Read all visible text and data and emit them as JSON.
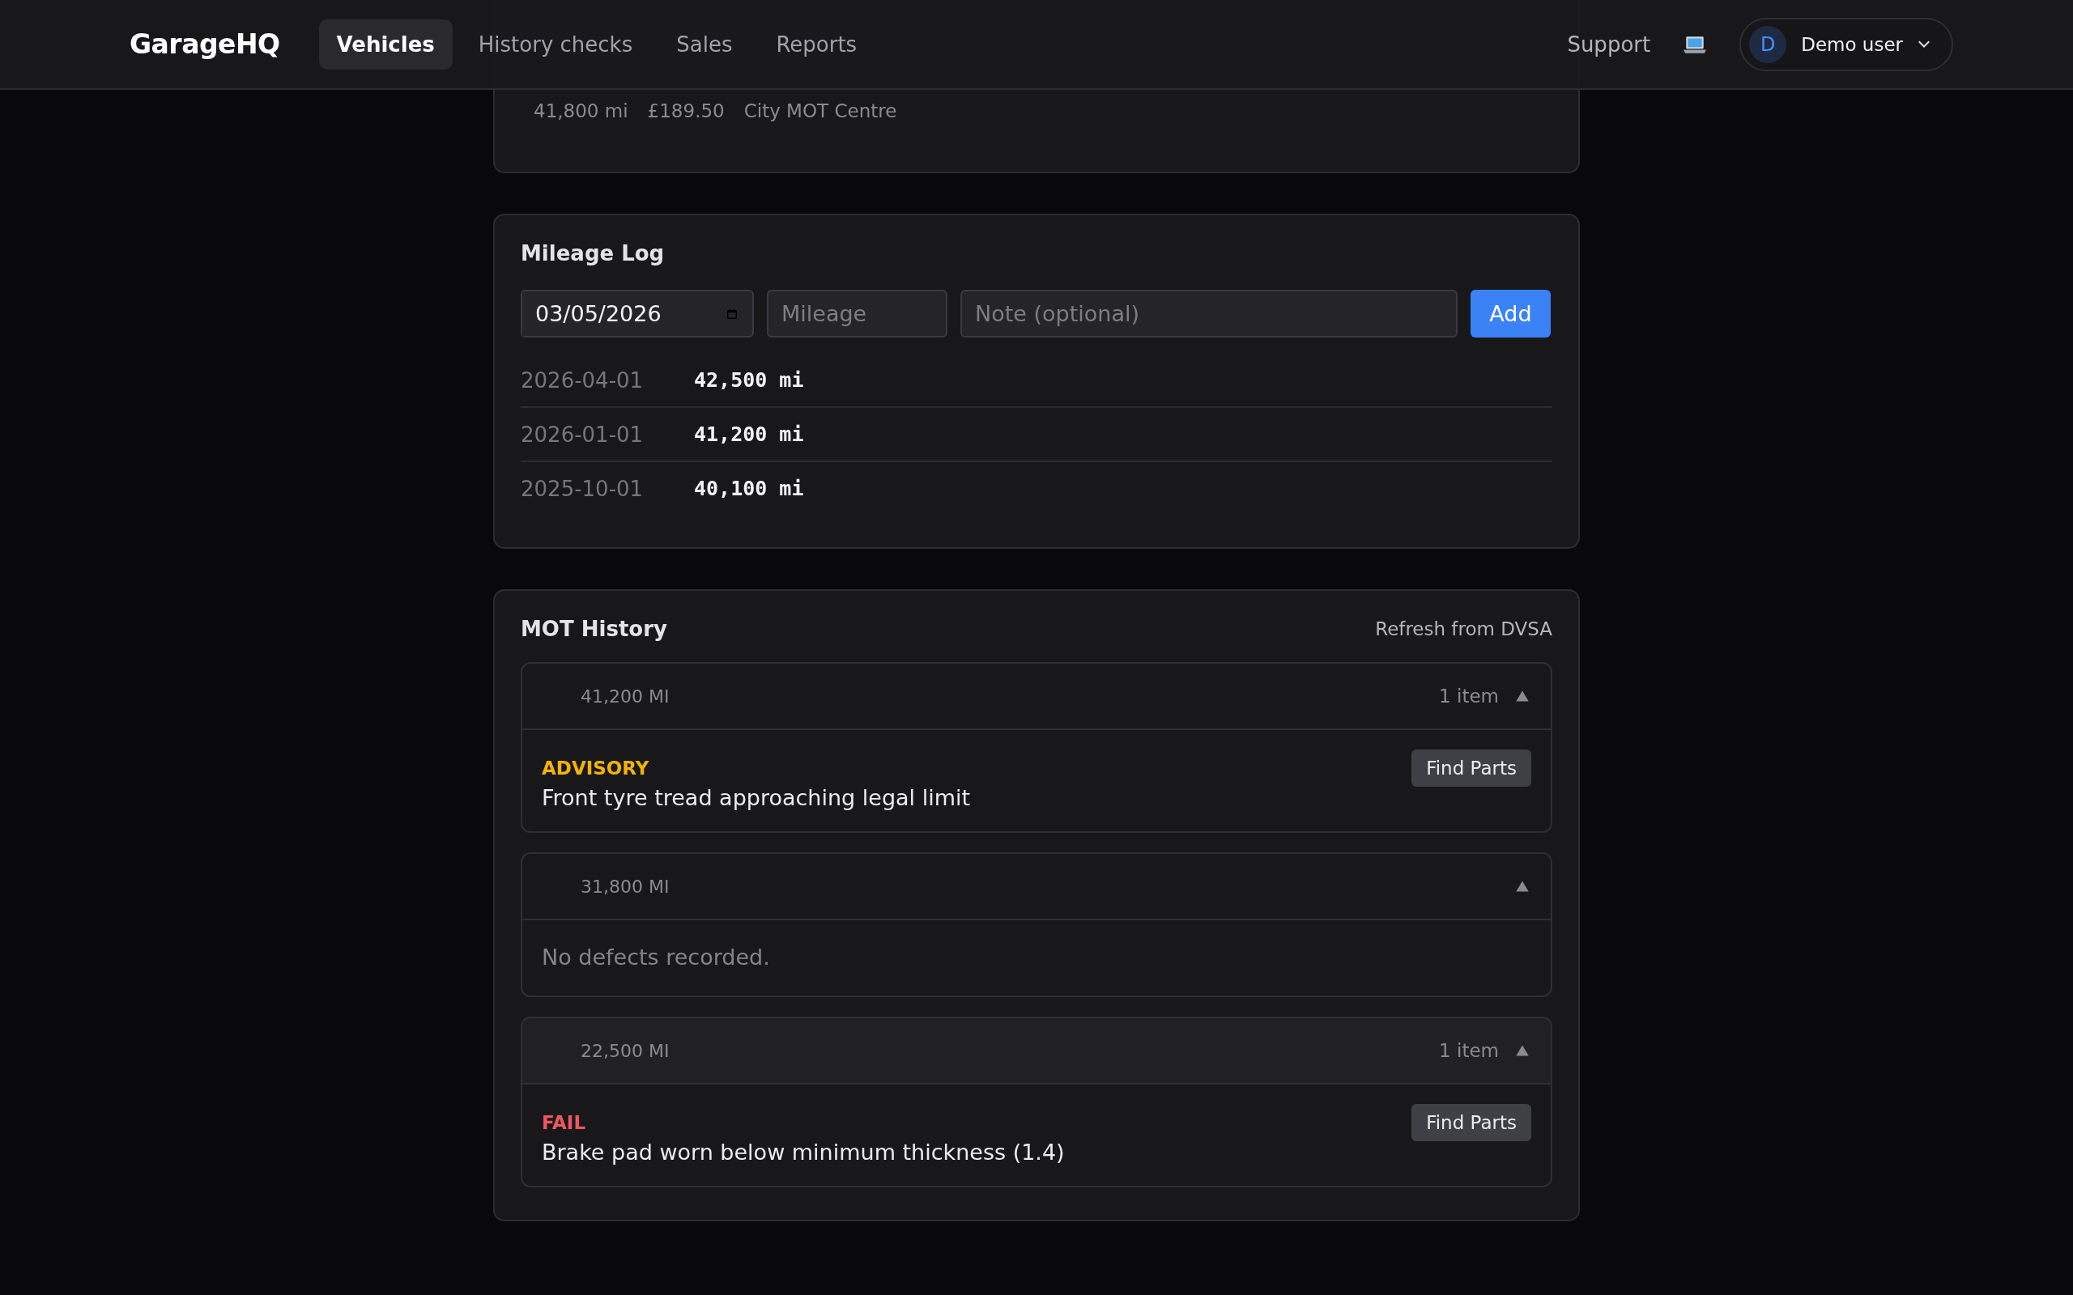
{
  "header": {
    "logo": "GarageHQ",
    "nav": [
      {
        "label": "Vehicles",
        "selected": true
      },
      {
        "label": "History checks",
        "selected": false
      },
      {
        "label": "Sales",
        "selected": false
      },
      {
        "label": "Reports",
        "selected": false
      }
    ],
    "support": "Support",
    "user": {
      "initial": "D",
      "name": "Demo user"
    }
  },
  "service_card": {
    "meta": [
      "41,800 mi",
      "£189.50",
      "City MOT Centre"
    ]
  },
  "mileage_log": {
    "title": "Mileage Log",
    "date_field": {
      "value": "03/05/2026"
    },
    "mileage_field": {
      "placeholder": "Mileage"
    },
    "note_field": {
      "placeholder": "Note (optional)"
    },
    "add_button": "Add",
    "entries": [
      {
        "date": "2026-04-01",
        "mileage": "42,500 mi"
      },
      {
        "date": "2026-01-01",
        "mileage": "41,200 mi"
      },
      {
        "date": "2025-10-01",
        "mileage": "40,100 mi"
      }
    ]
  },
  "mot_history": {
    "title": "MOT History",
    "refresh": "Refresh from DVSA",
    "tests": [
      {
        "mileage": "41,200 MI",
        "count": "1 item",
        "expanded": true,
        "defects": [
          {
            "color": "#f5b400",
            "label": "ADVISORY",
            "text": "Front tyre tread approaching legal limit",
            "button": "Find Parts"
          }
        ]
      },
      {
        "mileage": "31,800 MI",
        "expanded": true,
        "empty_text": "No defects recorded."
      },
      {
        "mileage": "22,500 MI",
        "count": "1 item",
        "expanded": true,
        "defects": [
          {
            "color": "#f0565f",
            "label": "FAIL",
            "text": "Brake pad worn below minimum thickness (1.4)",
            "button": "Find Parts"
          }
        ]
      }
    ]
  }
}
